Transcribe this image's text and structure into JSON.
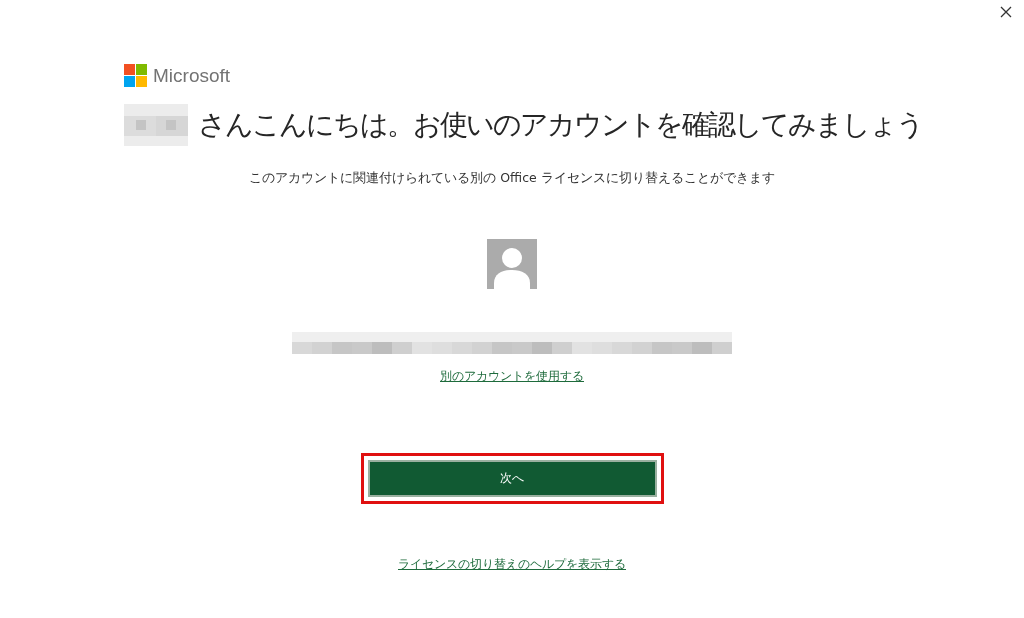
{
  "logo": {
    "text": "Microsoft"
  },
  "heading": "さんこんにちは。お使いのアカウントを確認してみましょう",
  "subtitle": "このアカウントに関連付けられている別の Office ライセンスに切り替えることができます",
  "account": {
    "link": "別のアカウントを使用する"
  },
  "next_button": {
    "label": "次へ",
    "highlighted": true
  },
  "help_link": "ライセンスの切り替えのヘルプを表示する"
}
